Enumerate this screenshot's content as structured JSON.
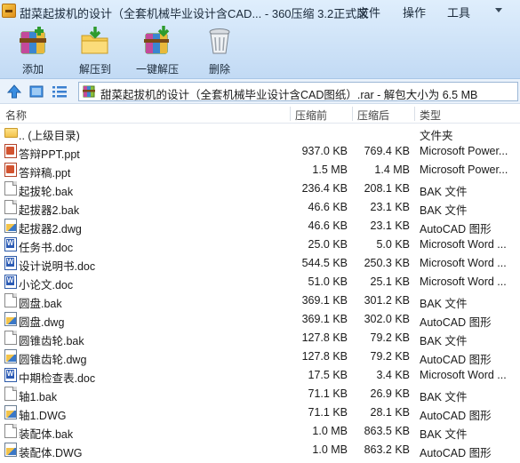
{
  "window": {
    "title": "甜菜起拔机的设计（全套机械毕业设计含CAD... - 360压缩 3.2正式版"
  },
  "menu": {
    "file": "文件",
    "operation": "操作",
    "tools": "工具"
  },
  "toolbar": {
    "add": "添加",
    "extract_to": "解压到",
    "one_click_extract": "一键解压",
    "delete": "删除"
  },
  "address": {
    "path": "甜菜起拔机的设计（全套机械毕业设计含CAD图纸）.rar - 解包大小为 6.5 MB"
  },
  "columns": {
    "name": "名称",
    "packed": "压缩前",
    "original": "压缩后",
    "type": "类型"
  },
  "files": [
    {
      "name": ".. (上级目录)",
      "packed": "",
      "original": "",
      "type": "文件夹",
      "icon": "folder-icon"
    },
    {
      "name": "答辩PPT.ppt",
      "packed": "937.0 KB",
      "original": "769.4 KB",
      "type": "Microsoft Power...",
      "icon": "ppt-icon"
    },
    {
      "name": "答辩稿.ppt",
      "packed": "1.5 MB",
      "original": "1.4 MB",
      "type": "Microsoft Power...",
      "icon": "ppt-icon"
    },
    {
      "name": "起拔轮.bak",
      "packed": "236.4 KB",
      "original": "208.1 KB",
      "type": "BAK 文件",
      "icon": "file-icon"
    },
    {
      "name": "起拔器2.bak",
      "packed": "46.6 KB",
      "original": "23.1 KB",
      "type": "BAK 文件",
      "icon": "file-icon"
    },
    {
      "name": "起拔器2.dwg",
      "packed": "46.6 KB",
      "original": "23.1 KB",
      "type": "AutoCAD 图形",
      "icon": "dwg-icon"
    },
    {
      "name": "任务书.doc",
      "packed": "25.0 KB",
      "original": "5.0 KB",
      "type": "Microsoft Word ...",
      "icon": "word-icon"
    },
    {
      "name": "设计说明书.doc",
      "packed": "544.5 KB",
      "original": "250.3 KB",
      "type": "Microsoft Word ...",
      "icon": "word-icon"
    },
    {
      "name": "小论文.doc",
      "packed": "51.0 KB",
      "original": "25.1 KB",
      "type": "Microsoft Word ...",
      "icon": "word-icon"
    },
    {
      "name": "圆盘.bak",
      "packed": "369.1 KB",
      "original": "301.2 KB",
      "type": "BAK 文件",
      "icon": "file-icon"
    },
    {
      "name": "圆盘.dwg",
      "packed": "369.1 KB",
      "original": "302.0 KB",
      "type": "AutoCAD 图形",
      "icon": "dwg-icon"
    },
    {
      "name": "圆锥齿轮.bak",
      "packed": "127.8 KB",
      "original": "79.2 KB",
      "type": "BAK 文件",
      "icon": "file-icon"
    },
    {
      "name": "圆锥齿轮.dwg",
      "packed": "127.8 KB",
      "original": "79.2 KB",
      "type": "AutoCAD 图形",
      "icon": "dwg-icon"
    },
    {
      "name": "中期检查表.doc",
      "packed": "17.5 KB",
      "original": "3.4 KB",
      "type": "Microsoft Word ...",
      "icon": "word-icon"
    },
    {
      "name": "轴1.bak",
      "packed": "71.1 KB",
      "original": "26.9 KB",
      "type": "BAK 文件",
      "icon": "file-icon"
    },
    {
      "name": "轴1.DWG",
      "packed": "71.1 KB",
      "original": "28.1 KB",
      "type": "AutoCAD 图形",
      "icon": "dwg-icon"
    },
    {
      "name": "装配体.bak",
      "packed": "1.0 MB",
      "original": "863.5 KB",
      "type": "BAK 文件",
      "icon": "file-icon"
    },
    {
      "name": "装配体.DWG",
      "packed": "1.0 MB",
      "original": "863.2 KB",
      "type": "AutoCAD 图形",
      "icon": "dwg-icon"
    }
  ]
}
